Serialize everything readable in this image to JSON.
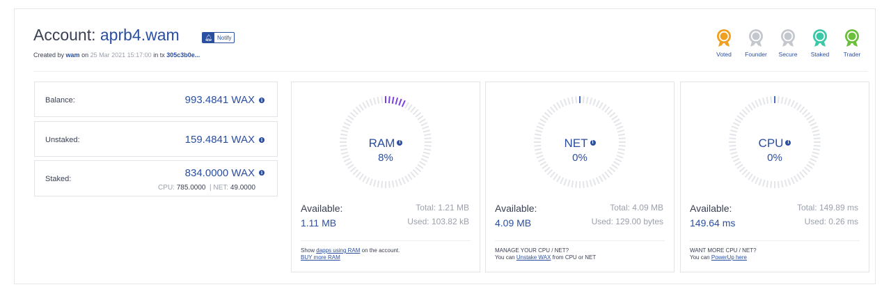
{
  "header": {
    "title_prefix": "Account:",
    "account_name": "aprb4.wam",
    "notify_label": "Notify",
    "created_by_label": "Created by",
    "creator": "wam",
    "on_label": "on",
    "created_date": "25 Mar 2021 15:17:00",
    "in_tx_label": "in tx",
    "tx_id": "305c3b0e..."
  },
  "badges": [
    {
      "name": "Voted",
      "icon": "voted-medal-icon",
      "color": "#f0a020"
    },
    {
      "name": "Founder",
      "icon": "founder-medal-icon",
      "color": "#c4c7cd"
    },
    {
      "name": "Secure",
      "icon": "secure-medal-icon",
      "color": "#c4c7cd"
    },
    {
      "name": "Staked",
      "icon": "staked-medal-icon",
      "color": "#3cc8a8"
    },
    {
      "name": "Trader",
      "icon": "trader-medal-icon",
      "color": "#6cbf3a"
    }
  ],
  "balances": {
    "balance": {
      "label": "Balance:",
      "value": "993.4841 WAX"
    },
    "unstaked": {
      "label": "Unstaked:",
      "value": "159.4841 WAX"
    },
    "staked": {
      "label": "Staked:",
      "value": "834.0000 WAX",
      "cpu_label": "CPU:",
      "cpu_value": "785.0000",
      "net_label": "| NET:",
      "net_value": "49.0000"
    }
  },
  "resources": [
    {
      "name": "RAM",
      "percent": "8%",
      "percent_value": 8,
      "available_label": "Available:",
      "available": "1.11 MB",
      "total": "Total: 1.21 MB",
      "used": "Used: 103.82 kB",
      "foot_line1_pre": "Show",
      "foot_link1": "dapps using RAM",
      "foot_line1_post": "on the account.",
      "foot_line2_pre": "",
      "foot_link2": "BUY more RAM",
      "foot_line2_post": ""
    },
    {
      "name": "NET",
      "percent": "0%",
      "percent_value": 0,
      "available_label": "Available:",
      "available": "4.09 MB",
      "total": "Total: 4.09 MB",
      "used": "Used: 129.00 bytes",
      "foot_line1_pre": "MANAGE YOUR CPU / NET?",
      "foot_link1": "",
      "foot_line1_post": "",
      "foot_line2_pre": "You can",
      "foot_link2": "Unstake WAX",
      "foot_line2_post": "from CPU or NET"
    },
    {
      "name": "CPU",
      "percent": "0%",
      "percent_value": 0,
      "available_label": "Available:",
      "available": "149.64 ms",
      "total": "Total: 149.89 ms",
      "used": "Used: 0.26 ms",
      "foot_line1_pre": "WANT MORE CPU / NET?",
      "foot_link1": "",
      "foot_line1_post": "",
      "foot_line2_pre": "You can",
      "foot_link2": "PowerUp here",
      "foot_line2_post": ""
    }
  ],
  "colors": {
    "accent": "#2a4ea0",
    "gauge_track": "#e3e5e9",
    "gauge_fill": "#7b3fe4",
    "muted_text": "#9aa0ac"
  }
}
